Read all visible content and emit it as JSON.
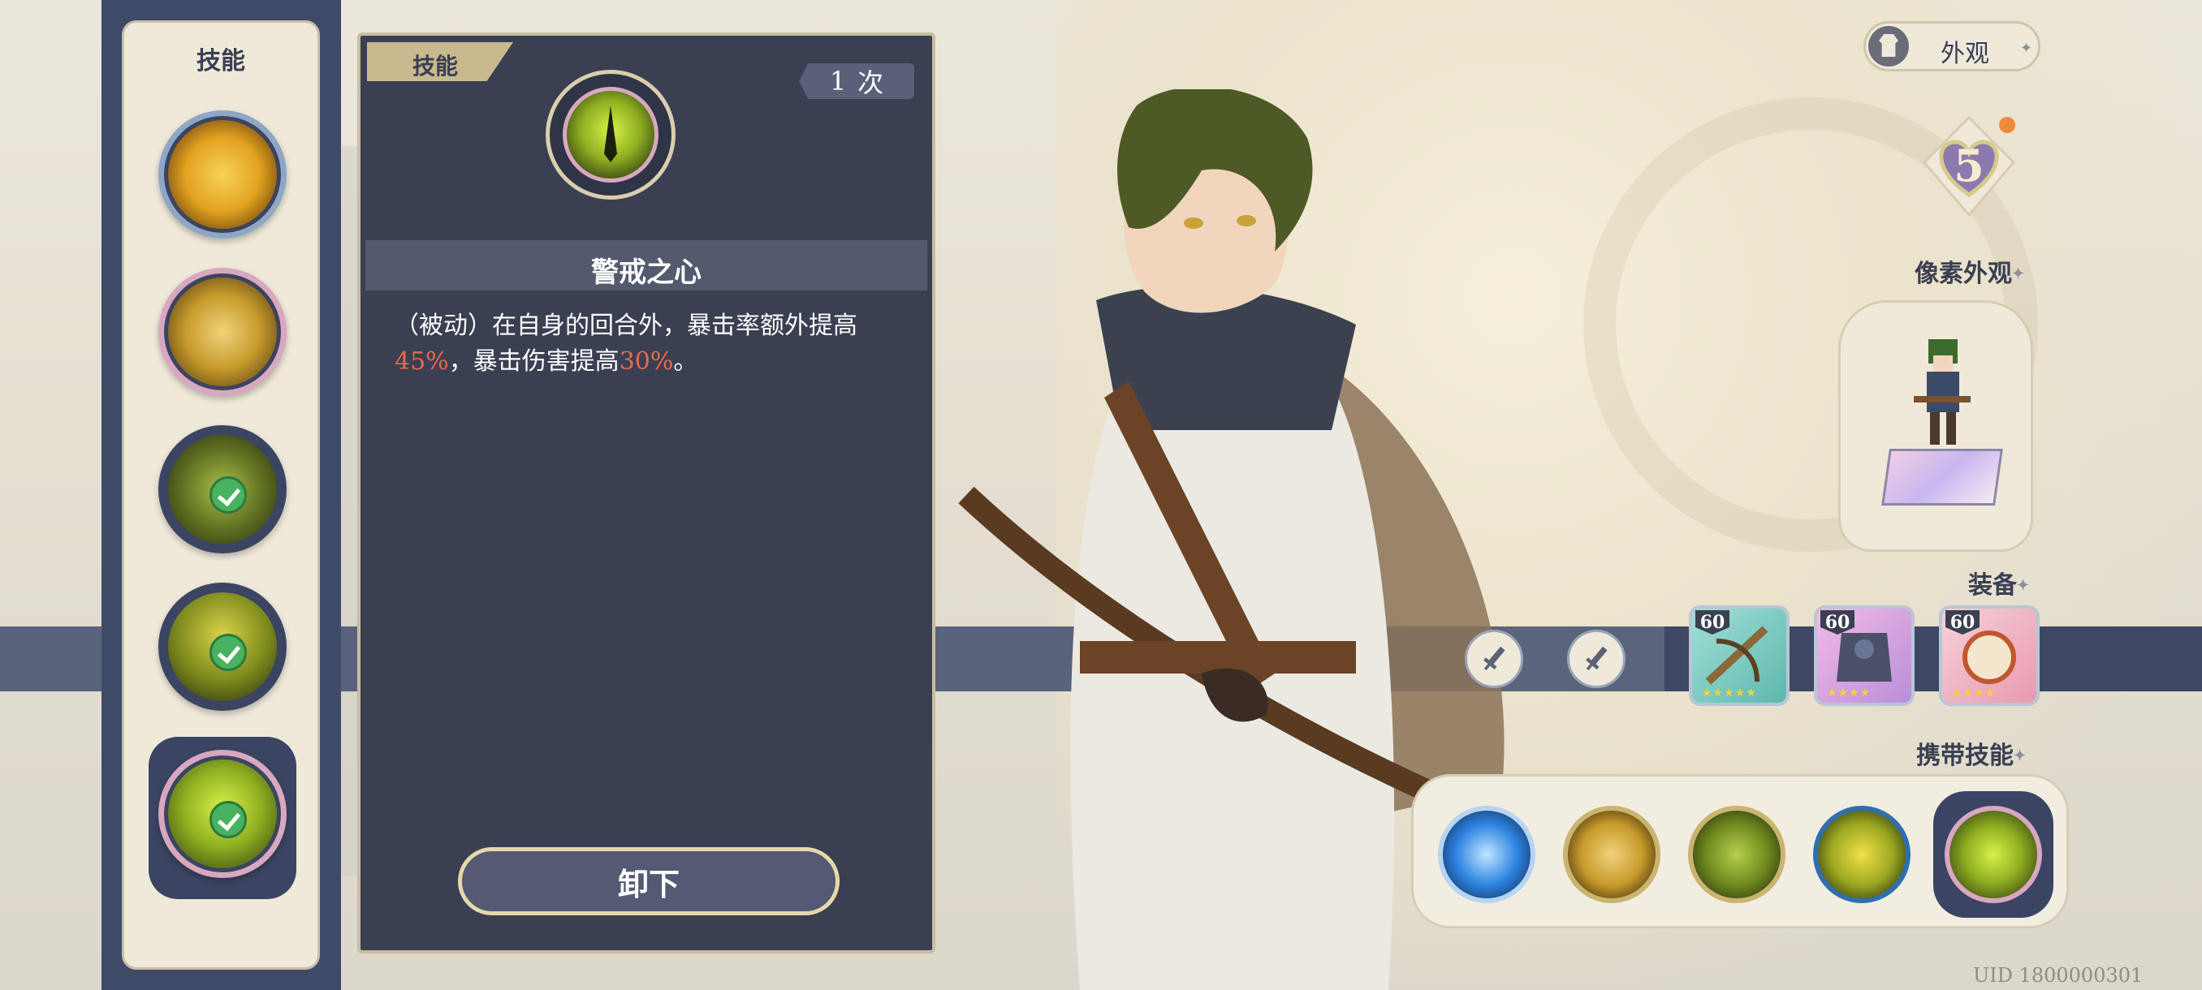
{
  "sidebar": {
    "title": "技能",
    "skills": [
      {
        "name": "skill-arrow-burst",
        "equipped": false,
        "color": "#e3a320"
      },
      {
        "name": "skill-archer-shot",
        "equipped": false,
        "color": "#d7a53a"
      },
      {
        "name": "skill-arrow-rain",
        "equipped": true,
        "color": "#7a8e2c"
      },
      {
        "name": "skill-sun-archer",
        "equipped": true,
        "color": "#8a9a22"
      },
      {
        "name": "skill-vigilant-heart",
        "equipped": true,
        "selected": true,
        "color": "#9cb82a"
      }
    ]
  },
  "detail": {
    "tab_label": "技能",
    "count_value": "1",
    "count_unit": "次",
    "skill_name": "警戒之心",
    "desc_part1": "（被动）在自身的回合外，暴击率额外提高",
    "desc_value1": "45%",
    "desc_part2": "，暴击伤害提高",
    "desc_value2": "30%",
    "desc_part3": "。",
    "unequip_label": "卸下"
  },
  "right_panel": {
    "appearance_label": "外观",
    "level": "5",
    "pixel_appearance_label": "像素外观",
    "equipment_label": "装备",
    "equipment": [
      {
        "level": "60",
        "stars": "★★★★★",
        "icon": "crossbow-icon",
        "color": "#6fc6bd"
      },
      {
        "level": "60",
        "stars": "★★★★",
        "icon": "armor-icon",
        "color": "#c07fbf"
      },
      {
        "level": "60",
        "stars": "★★★★",
        "icon": "scroll-icon",
        "color": "#e89a9a"
      }
    ],
    "carried_skills_label": "携带技能",
    "carried_skills": [
      {
        "icon": "blue-burst-icon",
        "color": "#2d83e0"
      },
      {
        "icon": "archer-shot-icon",
        "color": "#c7a22b"
      },
      {
        "icon": "arrow-rain-icon",
        "color": "#7f9a22"
      },
      {
        "icon": "sun-archer-icon",
        "color": "#9ca820"
      },
      {
        "icon": "vigilant-heart-icon",
        "color": "#9cb82a",
        "selected": true
      }
    ]
  },
  "uid_text": "UID 1800000301"
}
